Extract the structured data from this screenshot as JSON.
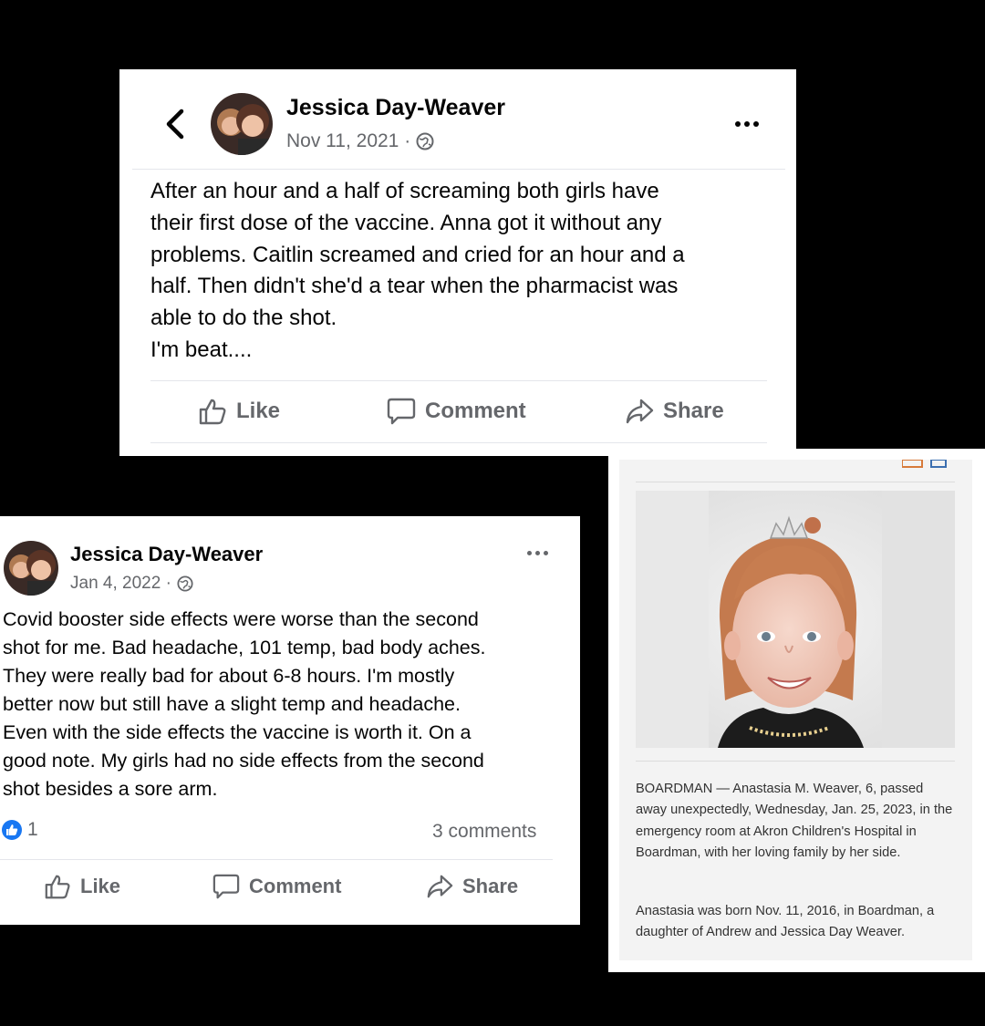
{
  "post1": {
    "author": "Jessica Day-Weaver",
    "date": "Nov 11, 2021 ·",
    "body": "After an hour and a half of screaming both girls have\ntheir first dose of the vaccine. Anna got it without any\nproblems. Caitlin screamed and cried for an hour and a\nhalf. Then didn't she'd a tear when the pharmacist was\nable to do the shot.\nI'm beat....",
    "actions": {
      "like": "Like",
      "comment": "Comment",
      "share": "Share"
    }
  },
  "post2": {
    "author": "Jessica Day-Weaver",
    "date": "Jan 4, 2022 ·",
    "body": "Covid booster side effects were worse than the second\nshot for me. Bad headache, 101 temp, bad body aches.\nThey were really bad for about 6-8 hours. I'm mostly\nbetter now but still have a slight temp and headache.\nEven with the side effects the vaccine is worth it. On a\ngood note. My girls had no side effects from the second\nshot besides a sore arm.",
    "reactions_count": "1",
    "comments_count": "3 comments",
    "actions": {
      "like": "Like",
      "comment": "Comment",
      "share": "Share"
    }
  },
  "obituary": {
    "paragraph1": "BOARDMAN — Anastasia M. Weaver, 6, passed away unexpectedly, Wednesday, Jan. 25, 2023, in the emergency room at Akron Children's Hospital in Boardman, with her loving family by her side.",
    "paragraph2": "Anastasia was born Nov. 11, 2016, in Boardman, a daughter of Andrew and Jessica Day Weaver."
  },
  "icons": [
    "back-chevron-icon",
    "globe-icon",
    "more-dots-icon",
    "like-thumb-icon",
    "comment-bubble-icon",
    "share-arrow-icon",
    "like-reaction-icon",
    "email-icon",
    "print-icon"
  ],
  "colors": {
    "background": "#000000",
    "card": "#ffffff",
    "secondary_text": "#65676b",
    "like_blue": "#1877f2",
    "obit_panel": "#f3f3f3"
  }
}
